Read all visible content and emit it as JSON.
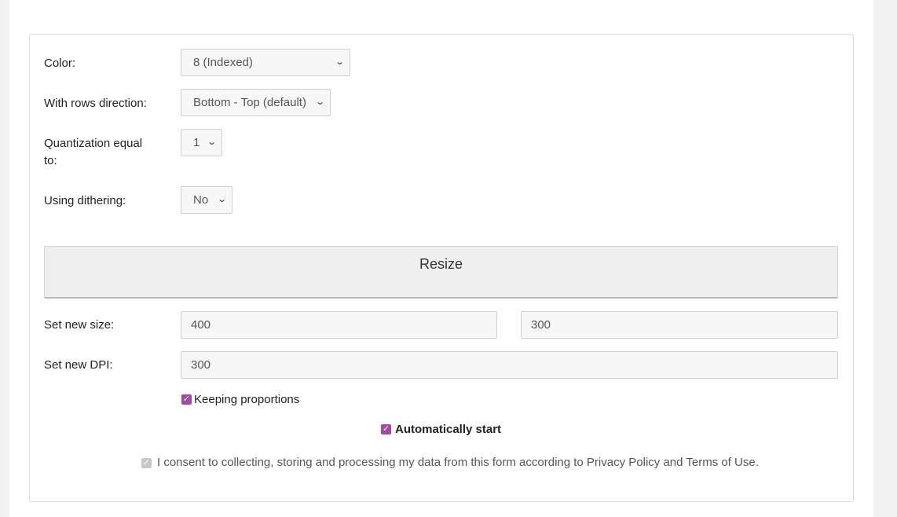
{
  "form": {
    "color": {
      "label": "Color:",
      "value": "8 (Indexed)"
    },
    "rows_direction": {
      "label": "With rows direction:",
      "value": "Bottom - Top (default)"
    },
    "quantization": {
      "label_line1": "Quantization equal",
      "label_line2": "to:",
      "value": "1"
    },
    "dithering": {
      "label": "Using dithering:",
      "value": "No"
    },
    "resize_button": "Resize",
    "new_size": {
      "label": "Set new size:",
      "width": "400",
      "height": "300"
    },
    "new_dpi": {
      "label": "Set new DPI:",
      "value": "300"
    },
    "keep_proportions": {
      "label": "Keeping proportions",
      "checked": true
    },
    "auto_start": {
      "label": "Automatically start",
      "checked": true
    },
    "consent": {
      "text": "I consent to collecting, storing and processing my data from this form according to Privacy Policy and Terms of Use.",
      "checked": true
    }
  },
  "icons": {
    "select_arrow": "chevron-down-icon",
    "checkbox": "checkmark-icon"
  },
  "colors": {
    "accent": "#a349a4",
    "button_bg": "#efeff0",
    "field_bg": "#f7f7f7"
  }
}
